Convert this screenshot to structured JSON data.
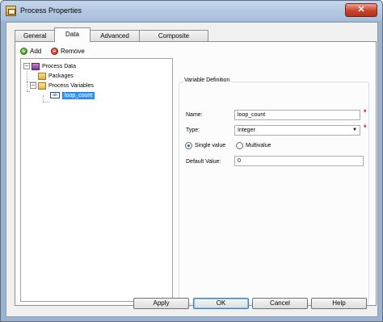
{
  "window": {
    "title": "Process Properties",
    "close_glyph": "✕"
  },
  "tabs": [
    {
      "label": "General"
    },
    {
      "label": "Data"
    },
    {
      "label": "Advanced"
    },
    {
      "label": "Composite Service"
    }
  ],
  "toolbar": {
    "add_label": "Add",
    "remove_label": "Remove"
  },
  "tree": {
    "root": {
      "label": "Process Data",
      "expander": "−"
    },
    "packages": {
      "label": "Packages"
    },
    "process_variables": {
      "label": "Process Variables",
      "expander": "−"
    },
    "variable": {
      "label": "loop_count",
      "icon_text": "ab"
    }
  },
  "definition": {
    "group_title": "Variable Definition",
    "name_label": "Name:",
    "name_value": "loop_count",
    "type_label": "Type:",
    "type_value": "Integer",
    "single_value_label": "Single value",
    "multivalue_label": "Multivalue",
    "default_value_label": "Default Value:",
    "default_value": "0",
    "required_marker": "*",
    "dropdown_arrow": "▼"
  },
  "buttons": {
    "apply": "Apply",
    "ok": "OK",
    "cancel": "Cancel",
    "help": "Help"
  }
}
